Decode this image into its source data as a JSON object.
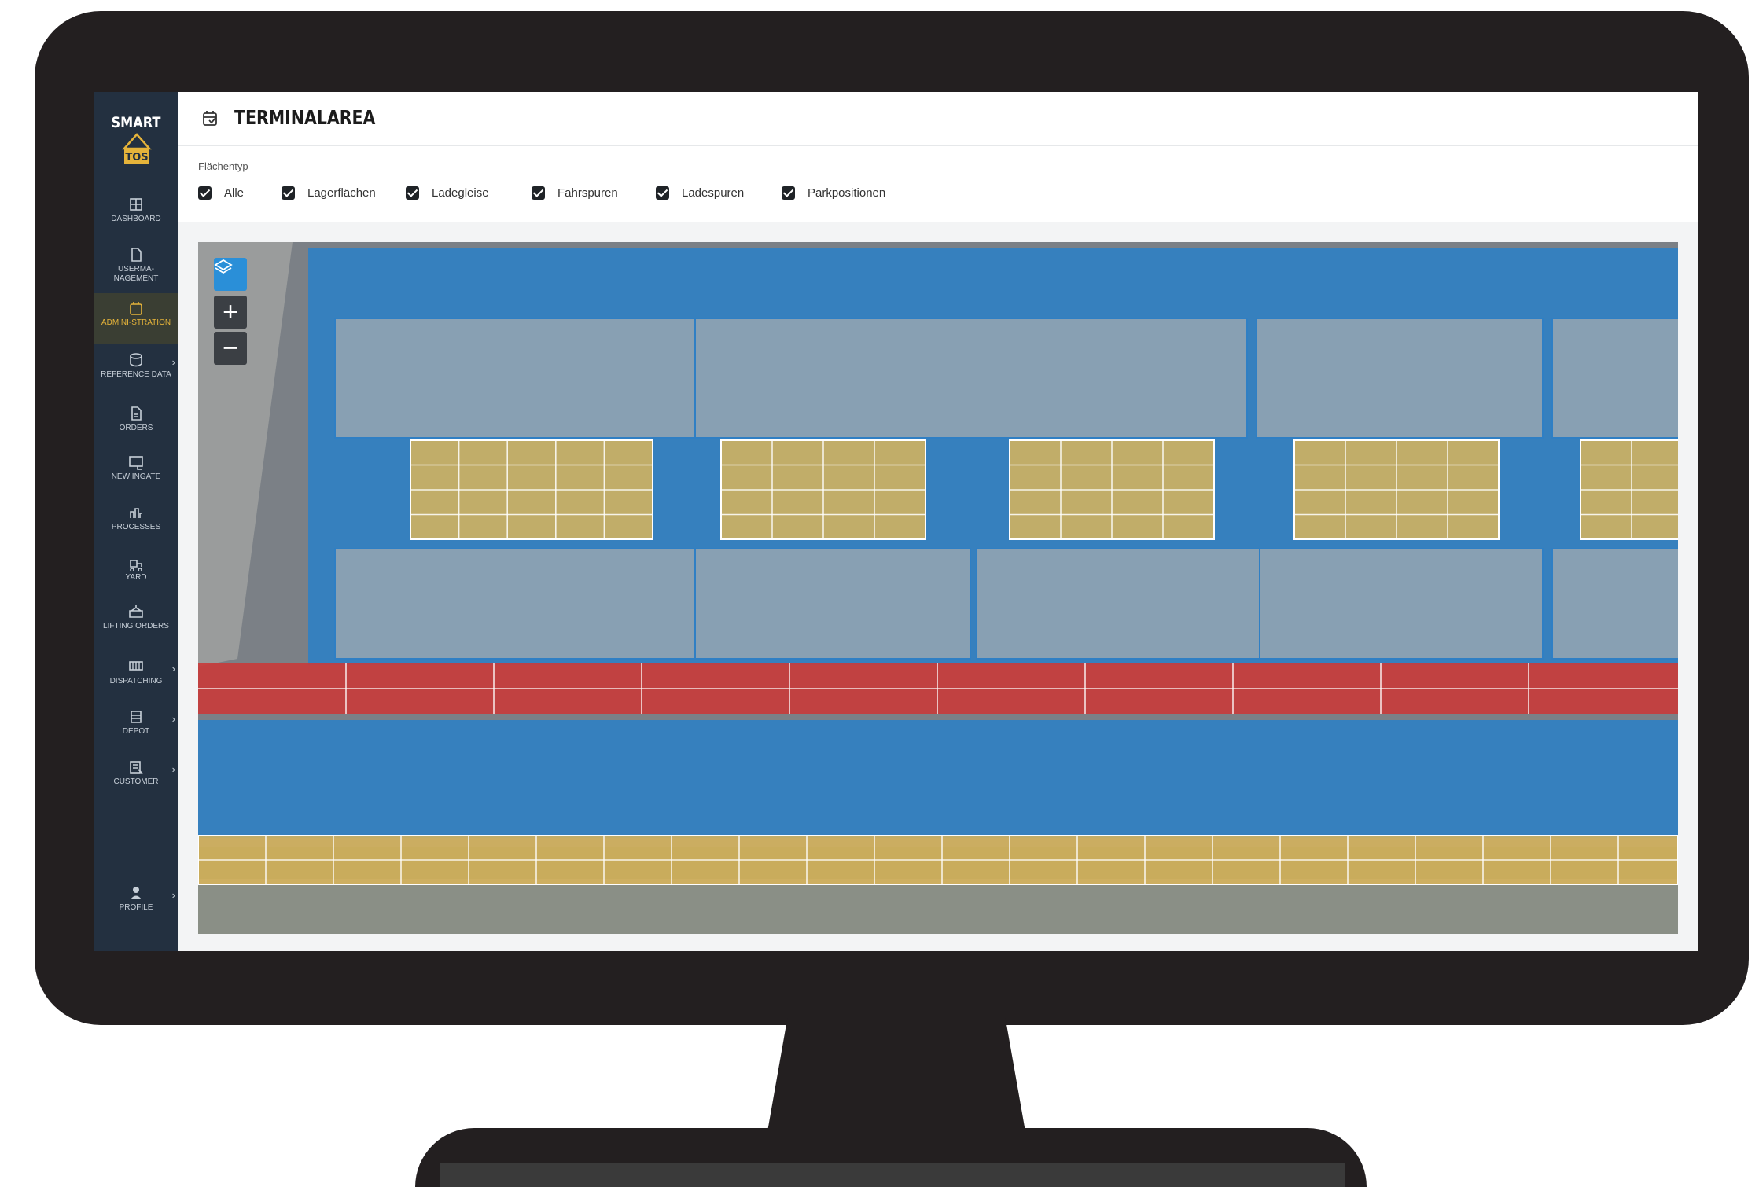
{
  "app": {
    "logo_text": "SMART",
    "logo_badge": "TOS"
  },
  "sidebar": {
    "items": [
      {
        "label": "DASHBOARD",
        "icon": "dashboard-icon",
        "active": false,
        "has_chevron": false
      },
      {
        "label": "USERMA-NAGEMENT",
        "icon": "user-management-icon",
        "active": false,
        "has_chevron": false
      },
      {
        "label": "ADMINI-STRATION",
        "icon": "administration-icon",
        "active": true,
        "has_chevron": false
      },
      {
        "label": "REFERENCE DATA",
        "icon": "reference-data-icon",
        "active": false,
        "has_chevron": true
      },
      {
        "label": "ORDERS",
        "icon": "orders-icon",
        "active": false,
        "has_chevron": false
      },
      {
        "label": "NEW INGATE",
        "icon": "ingate-icon",
        "active": false,
        "has_chevron": false
      },
      {
        "label": "PROCESSES",
        "icon": "processes-icon",
        "active": false,
        "has_chevron": false
      },
      {
        "label": "YARD",
        "icon": "yard-icon",
        "active": false,
        "has_chevron": false
      },
      {
        "label": "LIFTING ORDERS",
        "icon": "lifting-orders-icon",
        "active": false,
        "has_chevron": false
      },
      {
        "label": "DISPATCHING",
        "icon": "dispatching-icon",
        "active": false,
        "has_chevron": true
      },
      {
        "label": "DEPOT",
        "icon": "depot-icon",
        "active": false,
        "has_chevron": true
      },
      {
        "label": "CUSTOMER",
        "icon": "customer-icon",
        "active": false,
        "has_chevron": true
      },
      {
        "label": "PROFILE",
        "icon": "profile-icon",
        "active": false,
        "has_chevron": true
      }
    ]
  },
  "header": {
    "title": "TERMINALAREA",
    "icon": "terminal-area-icon"
  },
  "filters": {
    "title": "Flächentyp",
    "options": [
      {
        "label": "Alle",
        "checked": true
      },
      {
        "label": "Lagerflächen",
        "checked": true
      },
      {
        "label": "Ladegleise",
        "checked": true
      },
      {
        "label": "Fahrspuren",
        "checked": true
      },
      {
        "label": "Ladespuren",
        "checked": true
      },
      {
        "label": "Parkpositionen",
        "checked": true
      }
    ]
  },
  "map": {
    "controls": [
      "layers-icon",
      "zoom-in-icon",
      "zoom-out-icon"
    ],
    "colors": {
      "driving_lane": "#2f7fc4",
      "storage": "#8fa3b2",
      "parking": "#d9b55a",
      "track": "#c93a3a"
    }
  },
  "colors": {
    "sidebar_bg": "#233040",
    "accent": "#e5b33a",
    "bezel": "#231f20"
  }
}
